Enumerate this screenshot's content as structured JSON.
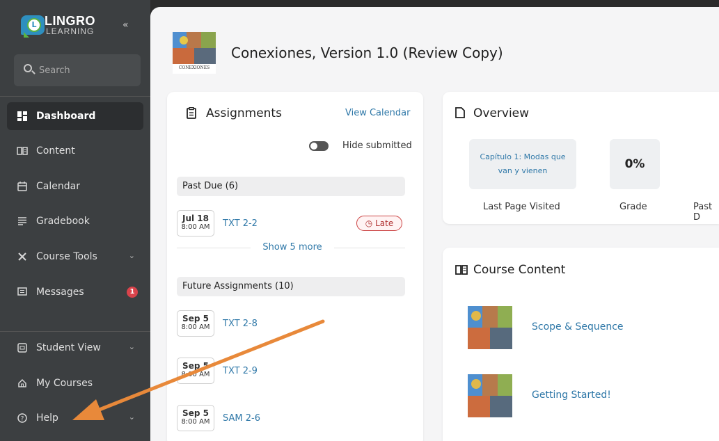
{
  "logo": {
    "line1": "LINGRO",
    "line2": "LEARNING"
  },
  "sidebar": {
    "collapse_glyph": "«",
    "search_placeholder": "Search",
    "items": [
      {
        "label": "Dashboard",
        "icon": "dashboard-icon"
      },
      {
        "label": "Content",
        "icon": "book-icon"
      },
      {
        "label": "Calendar",
        "icon": "calendar-icon"
      },
      {
        "label": "Gradebook",
        "icon": "gradebook-icon"
      },
      {
        "label": "Course Tools",
        "icon": "tools-icon"
      },
      {
        "label": "Messages",
        "icon": "message-icon",
        "badge": "1"
      }
    ],
    "bottom_items": [
      {
        "label": "Student View",
        "icon": "student-view-icon"
      },
      {
        "label": "My Courses",
        "icon": "home-icon"
      },
      {
        "label": "Help",
        "icon": "help-icon"
      }
    ]
  },
  "course": {
    "title": "Conexiones, Version 1.0 (Review Copy)",
    "thumb_caption": "CONEXIONES"
  },
  "assignments": {
    "title": "Assignments",
    "view_calendar": "View Calendar",
    "hide_submitted": "Hide submitted",
    "past_due_label": "Past Due",
    "past_due_count": "(6)",
    "future_label": "Future Assignments",
    "future_count": "(10)",
    "show_more": "Show 5 more",
    "late_label": "Late",
    "past_items": [
      {
        "date": "Jul 18",
        "time": "8:00 AM",
        "name": "TXT 2-2"
      }
    ],
    "future_items": [
      {
        "date": "Sep 5",
        "time": "8:00 AM",
        "name": "TXT 2-8"
      },
      {
        "date": "Sep 5",
        "time": "8:00 AM",
        "name": "TXT 2-9"
      },
      {
        "date": "Sep 5",
        "time": "8:00 AM",
        "name": "SAM 2-6"
      }
    ]
  },
  "overview": {
    "title": "Overview",
    "last_page": "Capítulo 1: Modas que van y vienen",
    "last_page_label": "Last Page Visited",
    "grade_value": "0%",
    "grade_label": "Grade",
    "past_label": "Past D"
  },
  "course_content": {
    "title": "Course Content",
    "items": [
      {
        "label": "Scope & Sequence"
      },
      {
        "label": "Getting Started!"
      }
    ]
  },
  "colors": {
    "sidebar_bg": "#3c3f41",
    "link": "#2f78a8",
    "badge": "#d9434b",
    "arrow": "#e8893a"
  }
}
